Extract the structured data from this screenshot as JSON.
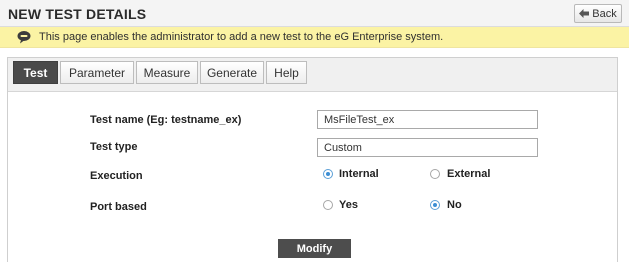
{
  "header": {
    "title": "NEW TEST DETAILS",
    "back_label": "Back"
  },
  "info": {
    "icon": "speech-bubble-icon",
    "text": "This page enables the administrator to add a new test to the eG Enterprise system."
  },
  "tabs": [
    {
      "label": "Test",
      "active": true
    },
    {
      "label": "Parameter",
      "active": false
    },
    {
      "label": "Measure",
      "active": false
    },
    {
      "label": "Generate",
      "active": false
    },
    {
      "label": "Help",
      "active": false
    }
  ],
  "form": {
    "test_name": {
      "label": "Test name (Eg: testname_ex)",
      "value": "MsFileTest_ex"
    },
    "test_type": {
      "label": "Test type",
      "value": "Custom"
    },
    "execution": {
      "label": "Execution",
      "options": [
        {
          "label": "Internal",
          "checked": true
        },
        {
          "label": "External",
          "checked": false
        }
      ]
    },
    "port_based": {
      "label": "Port based",
      "options": [
        {
          "label": "Yes",
          "checked": false
        },
        {
          "label": "No",
          "checked": true
        }
      ]
    },
    "submit_label": "Modify"
  },
  "colors": {
    "info_bar": "#fbf3a4",
    "active_tab": "#4a4a4a",
    "radio_checked": "#3d8fd4",
    "modify_button": "#4d4d4d"
  }
}
